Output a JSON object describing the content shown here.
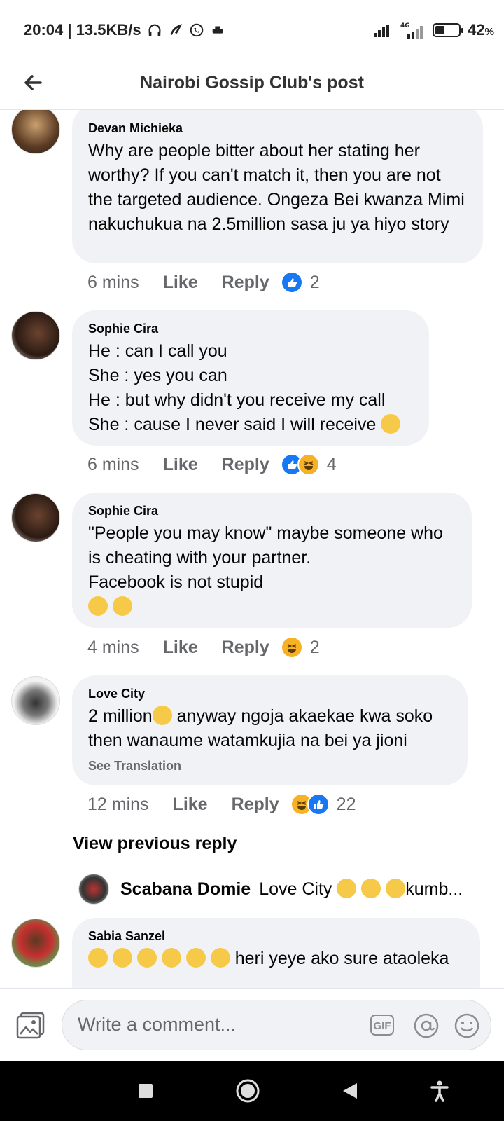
{
  "status_bar": {
    "time_speed": "20:04 | 13.5KB/s",
    "battery_percent": "42",
    "battery_suffix": "%",
    "battery_level": 0.42,
    "network": "4G"
  },
  "header": {
    "title": "Nairobi Gossip Club's post",
    "back_icon": "arrow-left-icon"
  },
  "comments": [
    {
      "author": "Devan Michieka",
      "text": "Why are people bitter about her stating her worthy? If you can't match it, then you are not the targeted audience. Ongeza Bei kwanza Mimi nakuchukua na 2.5million sasa ju ya hiyo story",
      "time": "6 mins",
      "like": "Like",
      "reply": "Reply",
      "reactions": [
        "like"
      ],
      "reaction_count": "2"
    },
    {
      "author": "Sophie Cira",
      "lines": [
        "He : can I call you",
        "She : yes you can",
        "He : but why didn't you receive my call",
        "She : cause I never said I will receive"
      ],
      "time": "6 mins",
      "like": "Like",
      "reply": "Reply",
      "reactions": [
        "like",
        "haha"
      ],
      "reaction_count": "4"
    },
    {
      "author": "Sophie Cira",
      "lines": [
        "\"People you may know\" maybe someone who",
        "is cheating with your partner.",
        "Facebook is not stupid"
      ],
      "time": "4 mins",
      "like": "Like",
      "reply": "Reply",
      "reactions": [
        "haha"
      ],
      "reaction_count": "2"
    },
    {
      "author": "Love City",
      "line1_a": "2 million",
      "line1_b": " anyway ngoja akaekae kwa soko",
      "line2": "then wanaume watamkujia na bei ya jioni",
      "see_translation": "See Translation",
      "time": "12 mins",
      "like": "Like",
      "reply": "Reply",
      "reactions": [
        "haha",
        "like"
      ],
      "reaction_count": "22"
    }
  ],
  "view_previous": "View previous reply",
  "nested_reply": {
    "author": "Scabana Domie",
    "text_a": "Love City ",
    "text_b": "kumb..."
  },
  "last_comment": {
    "author": "Sabia Sanzel",
    "text": " heri yeye ako sure ataoleka"
  },
  "composer": {
    "placeholder": "Write a comment...",
    "gif_label": "GIF"
  },
  "icons": [
    "photo-icon",
    "at-icon",
    "smile-icon",
    "square-icon",
    "circle-icon",
    "triangle-back-icon",
    "accessibility-icon"
  ],
  "colors": {
    "like_blue": "#1877f2",
    "haha_yellow": "#f7b125",
    "bubble_bg": "#f0f2f5",
    "meta_gray": "#65676b"
  }
}
